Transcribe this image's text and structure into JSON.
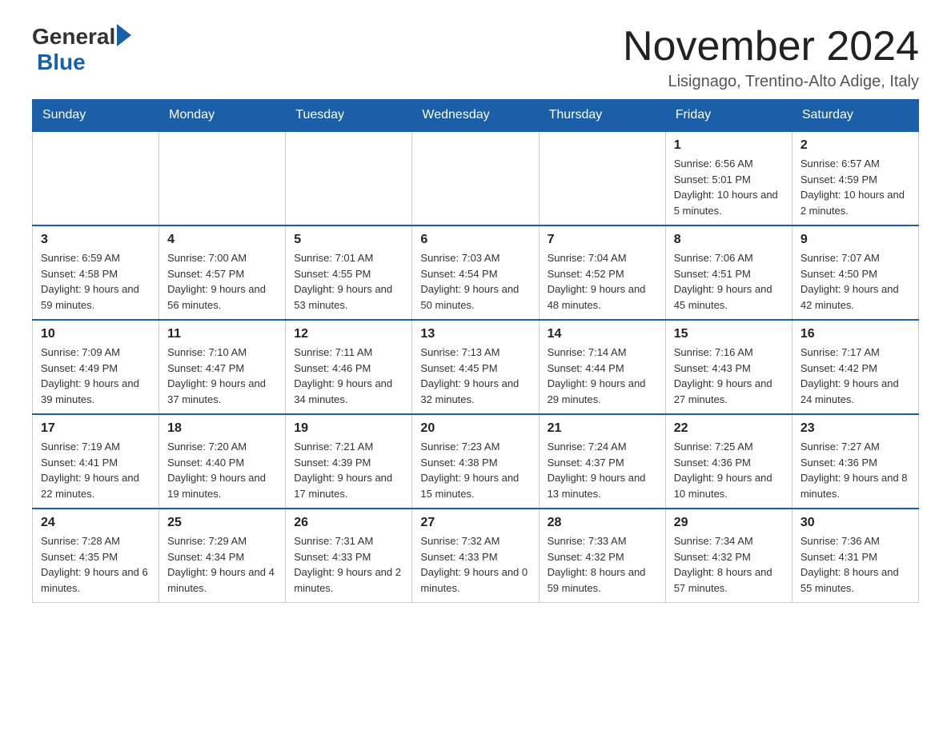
{
  "header": {
    "logo_general": "General",
    "logo_blue": "Blue",
    "month_year": "November 2024",
    "location": "Lisignago, Trentino-Alto Adige, Italy"
  },
  "days_of_week": [
    "Sunday",
    "Monday",
    "Tuesday",
    "Wednesday",
    "Thursday",
    "Friday",
    "Saturday"
  ],
  "weeks": [
    {
      "days": [
        {
          "number": "",
          "info": ""
        },
        {
          "number": "",
          "info": ""
        },
        {
          "number": "",
          "info": ""
        },
        {
          "number": "",
          "info": ""
        },
        {
          "number": "",
          "info": ""
        },
        {
          "number": "1",
          "info": "Sunrise: 6:56 AM\nSunset: 5:01 PM\nDaylight: 10 hours and 5 minutes."
        },
        {
          "number": "2",
          "info": "Sunrise: 6:57 AM\nSunset: 4:59 PM\nDaylight: 10 hours and 2 minutes."
        }
      ]
    },
    {
      "days": [
        {
          "number": "3",
          "info": "Sunrise: 6:59 AM\nSunset: 4:58 PM\nDaylight: 9 hours and 59 minutes."
        },
        {
          "number": "4",
          "info": "Sunrise: 7:00 AM\nSunset: 4:57 PM\nDaylight: 9 hours and 56 minutes."
        },
        {
          "number": "5",
          "info": "Sunrise: 7:01 AM\nSunset: 4:55 PM\nDaylight: 9 hours and 53 minutes."
        },
        {
          "number": "6",
          "info": "Sunrise: 7:03 AM\nSunset: 4:54 PM\nDaylight: 9 hours and 50 minutes."
        },
        {
          "number": "7",
          "info": "Sunrise: 7:04 AM\nSunset: 4:52 PM\nDaylight: 9 hours and 48 minutes."
        },
        {
          "number": "8",
          "info": "Sunrise: 7:06 AM\nSunset: 4:51 PM\nDaylight: 9 hours and 45 minutes."
        },
        {
          "number": "9",
          "info": "Sunrise: 7:07 AM\nSunset: 4:50 PM\nDaylight: 9 hours and 42 minutes."
        }
      ]
    },
    {
      "days": [
        {
          "number": "10",
          "info": "Sunrise: 7:09 AM\nSunset: 4:49 PM\nDaylight: 9 hours and 39 minutes."
        },
        {
          "number": "11",
          "info": "Sunrise: 7:10 AM\nSunset: 4:47 PM\nDaylight: 9 hours and 37 minutes."
        },
        {
          "number": "12",
          "info": "Sunrise: 7:11 AM\nSunset: 4:46 PM\nDaylight: 9 hours and 34 minutes."
        },
        {
          "number": "13",
          "info": "Sunrise: 7:13 AM\nSunset: 4:45 PM\nDaylight: 9 hours and 32 minutes."
        },
        {
          "number": "14",
          "info": "Sunrise: 7:14 AM\nSunset: 4:44 PM\nDaylight: 9 hours and 29 minutes."
        },
        {
          "number": "15",
          "info": "Sunrise: 7:16 AM\nSunset: 4:43 PM\nDaylight: 9 hours and 27 minutes."
        },
        {
          "number": "16",
          "info": "Sunrise: 7:17 AM\nSunset: 4:42 PM\nDaylight: 9 hours and 24 minutes."
        }
      ]
    },
    {
      "days": [
        {
          "number": "17",
          "info": "Sunrise: 7:19 AM\nSunset: 4:41 PM\nDaylight: 9 hours and 22 minutes."
        },
        {
          "number": "18",
          "info": "Sunrise: 7:20 AM\nSunset: 4:40 PM\nDaylight: 9 hours and 19 minutes."
        },
        {
          "number": "19",
          "info": "Sunrise: 7:21 AM\nSunset: 4:39 PM\nDaylight: 9 hours and 17 minutes."
        },
        {
          "number": "20",
          "info": "Sunrise: 7:23 AM\nSunset: 4:38 PM\nDaylight: 9 hours and 15 minutes."
        },
        {
          "number": "21",
          "info": "Sunrise: 7:24 AM\nSunset: 4:37 PM\nDaylight: 9 hours and 13 minutes."
        },
        {
          "number": "22",
          "info": "Sunrise: 7:25 AM\nSunset: 4:36 PM\nDaylight: 9 hours and 10 minutes."
        },
        {
          "number": "23",
          "info": "Sunrise: 7:27 AM\nSunset: 4:36 PM\nDaylight: 9 hours and 8 minutes."
        }
      ]
    },
    {
      "days": [
        {
          "number": "24",
          "info": "Sunrise: 7:28 AM\nSunset: 4:35 PM\nDaylight: 9 hours and 6 minutes."
        },
        {
          "number": "25",
          "info": "Sunrise: 7:29 AM\nSunset: 4:34 PM\nDaylight: 9 hours and 4 minutes."
        },
        {
          "number": "26",
          "info": "Sunrise: 7:31 AM\nSunset: 4:33 PM\nDaylight: 9 hours and 2 minutes."
        },
        {
          "number": "27",
          "info": "Sunrise: 7:32 AM\nSunset: 4:33 PM\nDaylight: 9 hours and 0 minutes."
        },
        {
          "number": "28",
          "info": "Sunrise: 7:33 AM\nSunset: 4:32 PM\nDaylight: 8 hours and 59 minutes."
        },
        {
          "number": "29",
          "info": "Sunrise: 7:34 AM\nSunset: 4:32 PM\nDaylight: 8 hours and 57 minutes."
        },
        {
          "number": "30",
          "info": "Sunrise: 7:36 AM\nSunset: 4:31 PM\nDaylight: 8 hours and 55 minutes."
        }
      ]
    }
  ]
}
